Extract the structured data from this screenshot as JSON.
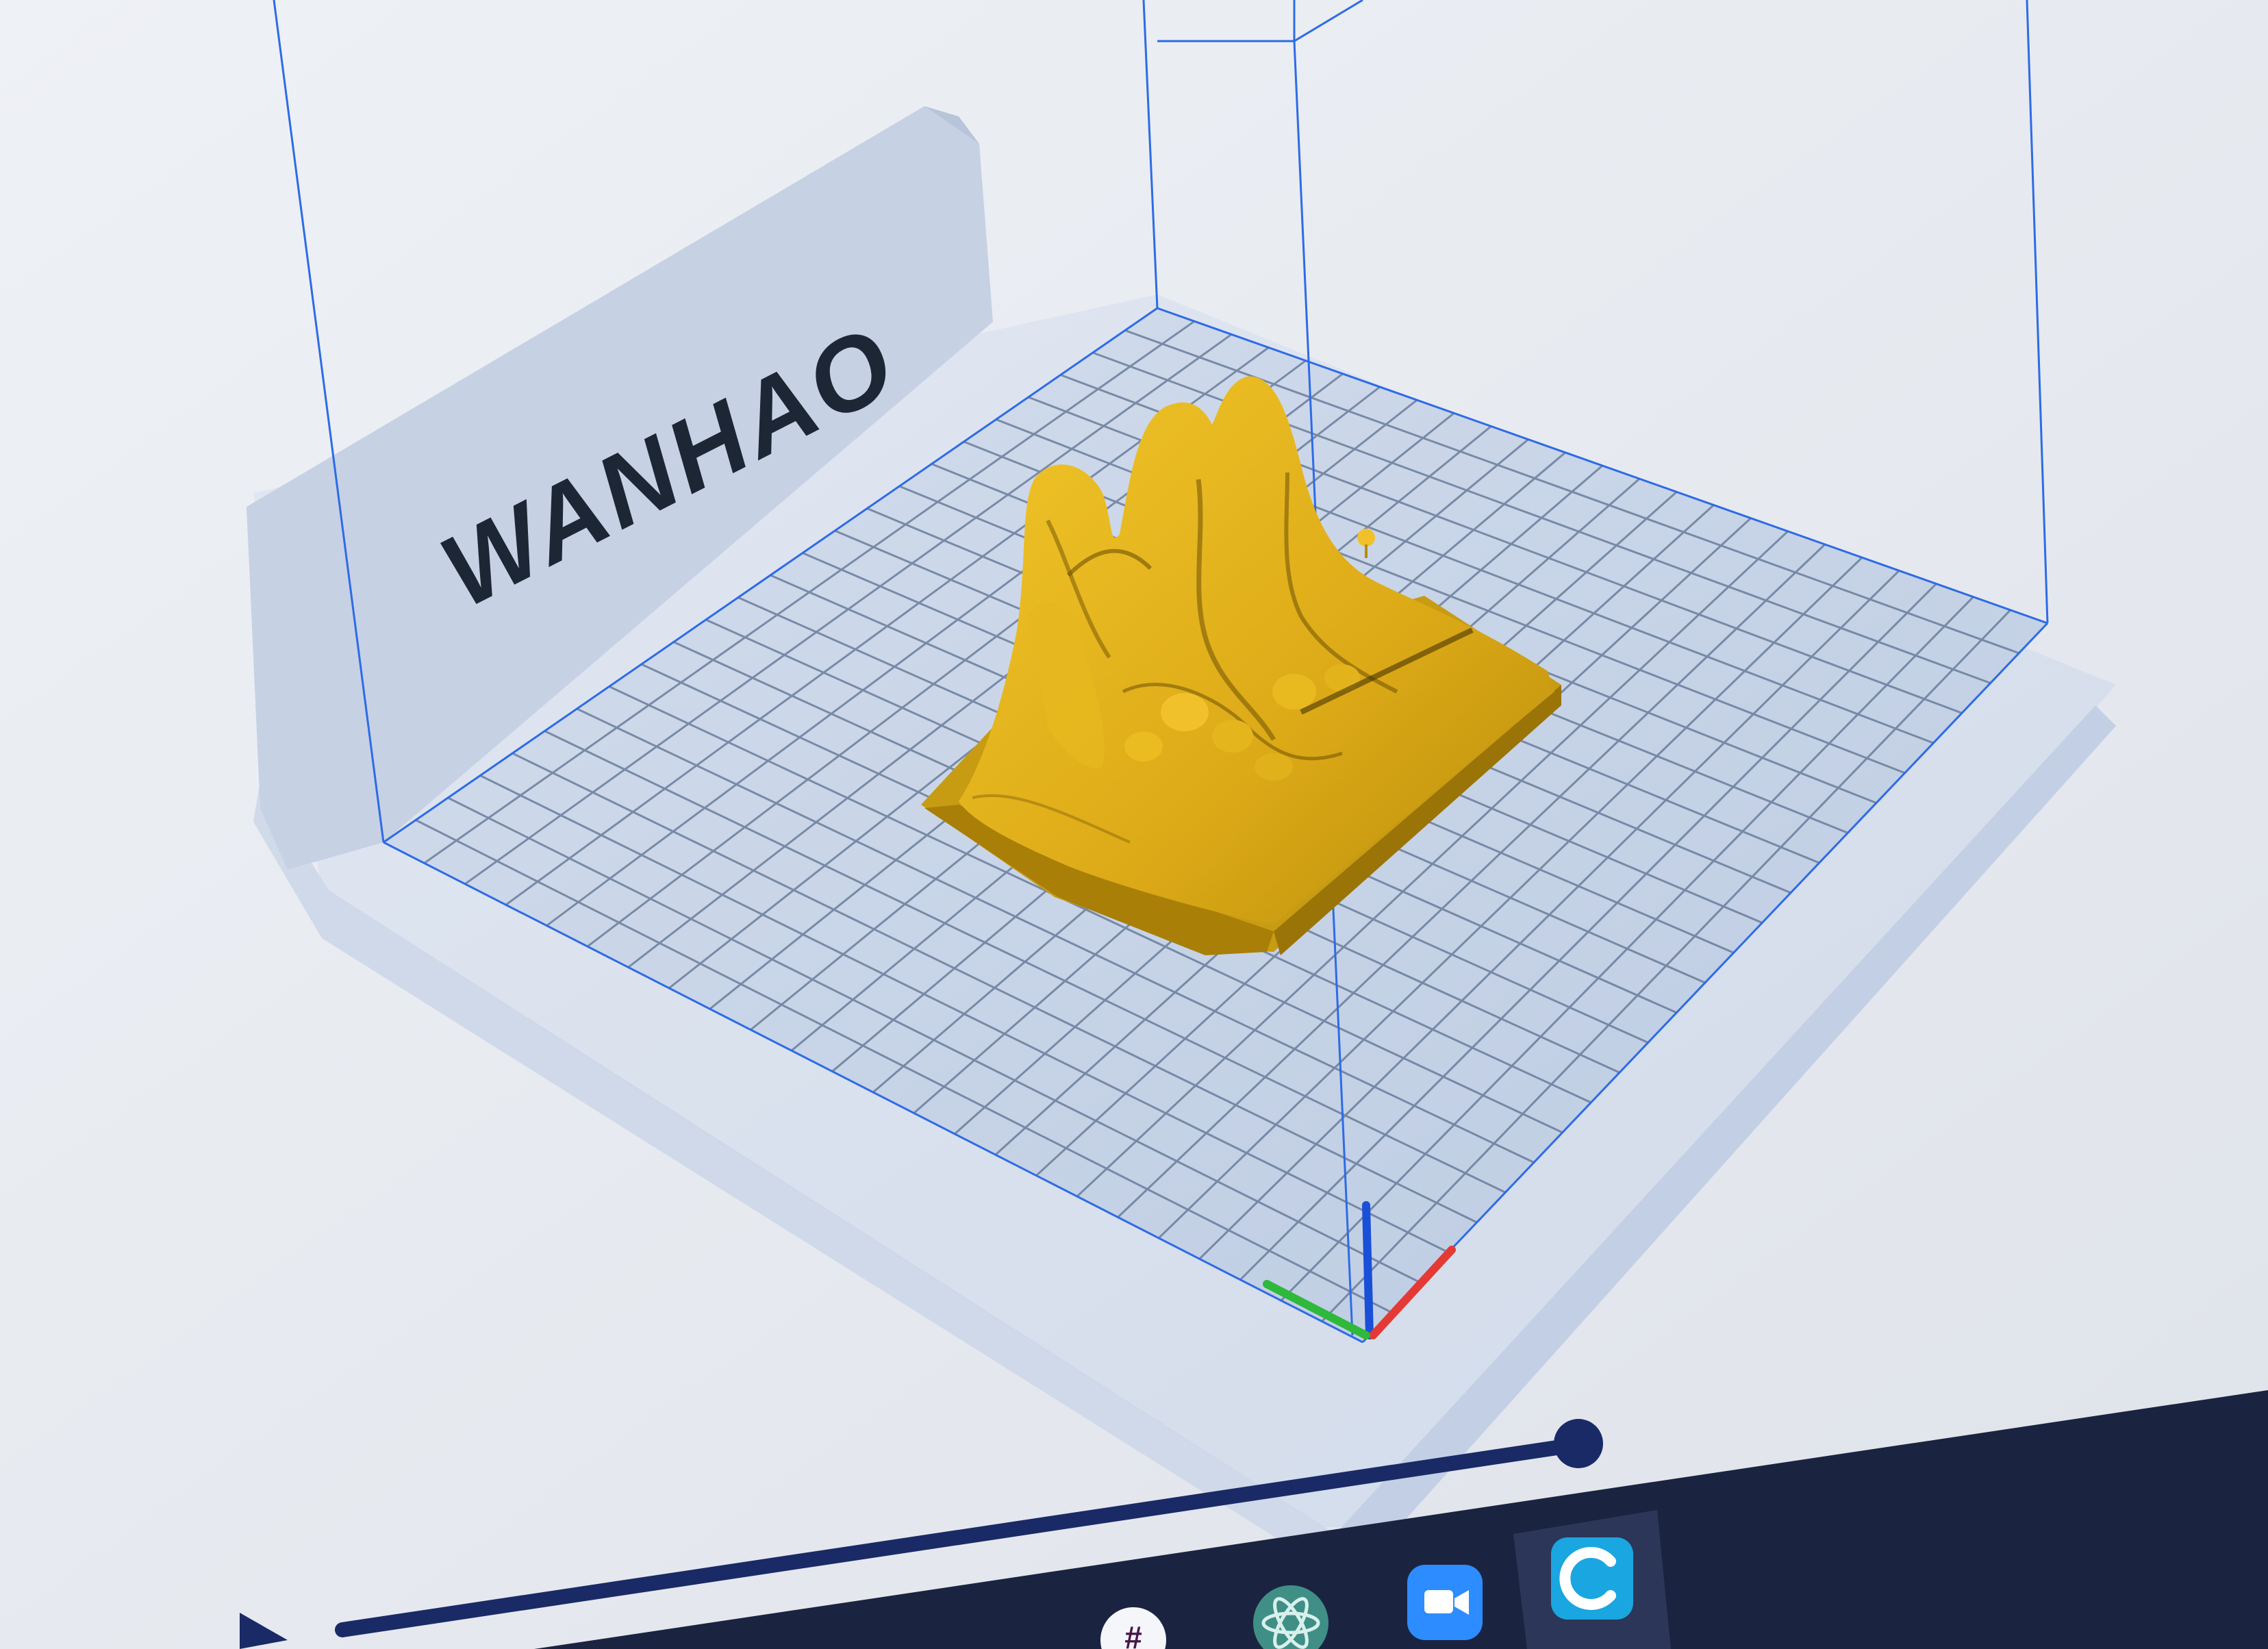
{
  "app": {
    "name": "Cura",
    "printer_brand_label": "WANHAO"
  },
  "viewport": {
    "build_plate": "printer-build-plate",
    "model": "mountain-terrain-model",
    "axes": {
      "x_color": "#e53935",
      "y_color": "#2eb83c",
      "z_color": "#1a4fd8"
    },
    "colors": {
      "background": "#e9ecf2",
      "plate": "#c5d2e6",
      "grid": "#5d7191",
      "volume_edge": "#2e6be6",
      "model": "#e0b21c",
      "model_shadow": "#8a6a08",
      "logo_panel": "#c9d4e6"
    }
  },
  "layer_slider": {
    "handle_color": "#1a2a66",
    "track_color": "#1a2a66",
    "play_icon": "play-icon"
  },
  "taskbar": {
    "icons": [
      {
        "name": "slack-icon",
        "color": "#ffffff"
      },
      {
        "name": "atom-icon",
        "color": "#3f8f86"
      },
      {
        "name": "zoom-icon",
        "color": "#2d8cff"
      },
      {
        "name": "cura-icon",
        "color": "#1aa6e0"
      }
    ]
  }
}
